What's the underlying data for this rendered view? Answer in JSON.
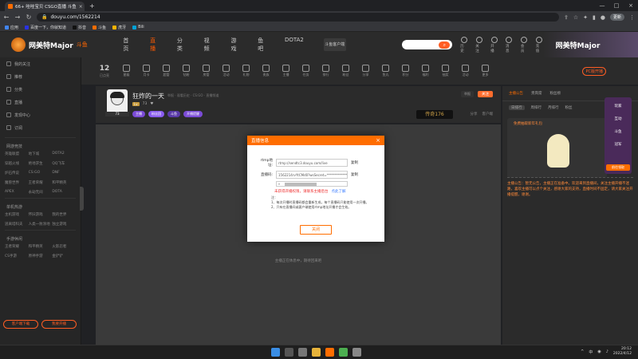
{
  "browser": {
    "tab_title": "66+ 哇哇宝贝 CSGO直播 斗鱼",
    "address": "douyu.com/1562214",
    "update_label": "更新"
  },
  "bookmarks": [
    {
      "label": "应用",
      "color": "#4285f4"
    },
    {
      "label": "百度一下，你就知道",
      "color": "#2932e1"
    },
    {
      "label": "抖音",
      "color": "#111111"
    },
    {
      "label": "斗鱼",
      "color": "#ff6d00"
    },
    {
      "label": "虎牙",
      "color": "#ffb300"
    },
    {
      "label": "Bili",
      "color": "#00a1d6"
    }
  ],
  "header": {
    "logo_text": "网美特Major",
    "logo_sub": "斗鱼",
    "nav": [
      "首页",
      "直播",
      "分类",
      "视频",
      "游戏",
      "鱼吧",
      "DOTA2"
    ],
    "nav_active": 1,
    "download_label": "斗鱼客户端",
    "icons": [
      "历史",
      "关注",
      "开播",
      "消息",
      "会员",
      "充值"
    ],
    "right_banner": "网美特Major"
  },
  "sidebar": {
    "items": [
      "我的关注",
      "推荐",
      "分类",
      "直播",
      "发现中心",
      "订阅"
    ],
    "section1": "网游竞技",
    "grid1": [
      "英雄联盟",
      "地下城",
      "DOTA2",
      "穿越火线",
      "绝地求生",
      "QQ飞车",
      "炉石传说",
      "CS:GO",
      "DNF",
      "魔兽世界",
      "王者荣耀",
      "和平精英",
      "APEX",
      "永劫无间",
      "DOTA"
    ],
    "section2": "单机热游",
    "grid2": [
      "主机游戏",
      "怀旧游戏",
      "我的世界",
      "逃离塔科夫",
      "人类一败涂地",
      "独立游戏"
    ],
    "section3": "手游休闲",
    "grid3": [
      "王者荣耀",
      "和平精英",
      "火影忍者",
      "CS手游",
      "原神手游",
      "金铲铲"
    ],
    "btn1": "客户端下载",
    "btn2": "我要开播"
  },
  "strip": {
    "count": "12",
    "count_label": "已点亮",
    "items": [
      "星级",
      "月卡",
      "超管",
      "钻粉",
      "房管",
      "活动",
      "礼物",
      "贵族",
      "主播",
      "任务",
      "排行",
      "粉丝",
      "分享",
      "鱼丸",
      "积分",
      "福利",
      "抽奖",
      "活动",
      "更多"
    ],
    "pc_label": "PC版开播"
  },
  "room": {
    "title": "狂炸的一天",
    "meta": "举报  ·  观看历史  ·  CS:GO  ·  直播频道",
    "level": "Lv",
    "fans": "73",
    "follow": "关注",
    "report": "举报",
    "tags": [
      "主播",
      "粉丝团",
      "斗鱼",
      "开播提醒"
    ],
    "banner": "传奇176",
    "share": [
      "分享",
      "客户端"
    ]
  },
  "video": {
    "no_signal": "主播正在休息中，期待回来吧"
  },
  "dialog": {
    "title": "直播信息",
    "rtmp_label": "rtmp地址:",
    "rtmp_value": "rtmp://sendtc3.douyu.com/live",
    "key_label": "直播码:",
    "key_value": "1562214rvYtCMd0?wsSecret=**************",
    "copy": "复制",
    "warning": "未获得开播权限，请联系主播后台",
    "warning_link": "点此了解",
    "notes_title": "注：",
    "note1": "1、每次开播时直播码都会重新生成，每个直播码只能使用一次开播。",
    "note2": "2、只有在直播间或客户端使用rtmp地址开播才会生效。",
    "close": "关闭"
  },
  "right_panel": {
    "tabs": [
      "主播公告",
      "贵宾席",
      "粉丝榜"
    ],
    "tabs2": [
      "日排行",
      "周排行",
      "月排行",
      "粉丝"
    ],
    "promo_text": "免费抽取新年礼包",
    "shield_lines": [
      "玩家",
      "互动",
      "斗鱼",
      "冠军"
    ],
    "shield_btn": "前往领取",
    "announcement": "主播公告：暂无公告，主播正在准备中。欢迎来到直播间，关注主播开播不迷路，喜欢主播可以点个关注，感谢大家的支持，直播时间不固定，请大家关注开播提醒，谢谢。"
  },
  "taskbar": {
    "time": "20:12",
    "date": "2022/4/12",
    "lang": "中"
  }
}
